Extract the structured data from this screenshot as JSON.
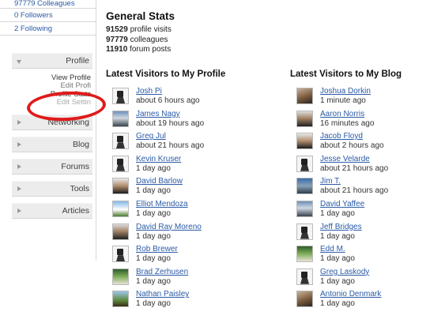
{
  "sidebar": {
    "stats": [
      {
        "label": "97779 Colleagues"
      },
      {
        "label": "0 Followers"
      },
      {
        "label": "2 Following"
      }
    ],
    "sections": [
      {
        "label": "Profile",
        "expanded": true
      },
      {
        "label": "Networking",
        "expanded": false
      },
      {
        "label": "Blog",
        "expanded": false
      },
      {
        "label": "Forums",
        "expanded": false
      },
      {
        "label": "Tools",
        "expanded": false
      },
      {
        "label": "Articles",
        "expanded": false
      }
    ],
    "profile_subitems": {
      "view": "View Profile",
      "edit": "Edit Profi",
      "stats": "Profile Stats",
      "ghost": "Edit Settin"
    }
  },
  "general_stats": {
    "title": "General Stats",
    "lines": [
      {
        "number": "91529",
        "label": "profile visits"
      },
      {
        "number": "97779",
        "label": "colleagues"
      },
      {
        "number": "11910",
        "label": "forum posts"
      }
    ]
  },
  "profile_visitors": {
    "title": "Latest Visitors to My Profile",
    "items": [
      {
        "name": "Josh Pi",
        "time": "about 6 hours ago",
        "avatar": "robot-icon"
      },
      {
        "name": "James Nagy",
        "time": "about 19 hours ago",
        "avatar": "photo-icon"
      },
      {
        "name": "Greg Jul",
        "time": "about 21 hours ago",
        "avatar": "robot-icon"
      },
      {
        "name": "Kevin Kruser",
        "time": "1 day ago",
        "avatar": "robot-icon"
      },
      {
        "name": "David Barlow",
        "time": "1 day ago",
        "avatar": "photo-icon"
      },
      {
        "name": "Elliot Mendoza",
        "time": "1 day ago",
        "avatar": "photo-icon"
      },
      {
        "name": "David Ray Moreno",
        "time": "1 day ago",
        "avatar": "photo-icon"
      },
      {
        "name": "Rob Brewer",
        "time": "1 day ago",
        "avatar": "robot-icon"
      },
      {
        "name": "Brad Zerhusen",
        "time": "1 day ago",
        "avatar": "photo-icon"
      },
      {
        "name": "Nathan Paisley",
        "time": "1 day ago",
        "avatar": "photo-icon"
      }
    ]
  },
  "blog_visitors": {
    "title": "Latest Visitors to My Blog",
    "items": [
      {
        "name": "Joshua Dorkin",
        "time": "1 minute ago",
        "avatar": "photo-icon"
      },
      {
        "name": "Aaron Norris",
        "time": "16 minutes ago",
        "avatar": "photo-icon"
      },
      {
        "name": "Jacob Floyd",
        "time": "about 2 hours ago",
        "avatar": "photo-icon"
      },
      {
        "name": "Jesse Velarde",
        "time": "about 21 hours ago",
        "avatar": "robot-icon"
      },
      {
        "name": "Jim T.",
        "time": "about 21 hours ago",
        "avatar": "photo-icon"
      },
      {
        "name": "David Yaffee",
        "time": "1 day ago",
        "avatar": "photo-icon"
      },
      {
        "name": "Jeff Bridges",
        "time": "1 day ago",
        "avatar": "robot-icon"
      },
      {
        "name": "Edd M.",
        "time": "1 day ago",
        "avatar": "photo-icon"
      },
      {
        "name": "Greg Laskody",
        "time": "1 day ago",
        "avatar": "robot-icon"
      },
      {
        "name": "Antonio Denmark",
        "time": "1 day ago",
        "avatar": "photo-icon"
      }
    ]
  },
  "colors": {
    "link": "#2a5aa6",
    "annotation_circle": "#e01a1a",
    "section_bg": "#ececec"
  }
}
